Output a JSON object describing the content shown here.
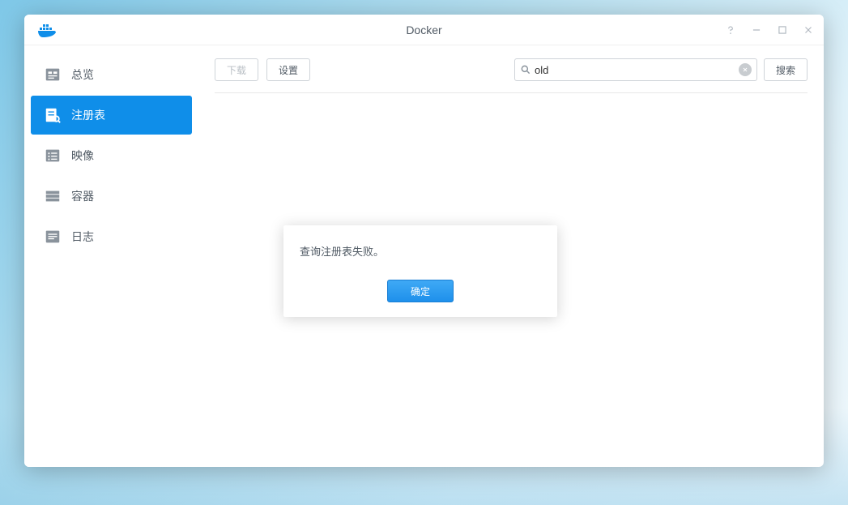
{
  "window": {
    "title": "Docker"
  },
  "sidebar": {
    "items": [
      {
        "label": "总览",
        "icon": "overview"
      },
      {
        "label": "注册表",
        "icon": "registry"
      },
      {
        "label": "映像",
        "icon": "image"
      },
      {
        "label": "容器",
        "icon": "container"
      },
      {
        "label": "日志",
        "icon": "log"
      }
    ],
    "active_index": 1
  },
  "toolbar": {
    "download_label": "下载",
    "settings_label": "设置",
    "search_value": "old",
    "search_button_label": "搜索"
  },
  "dialog": {
    "message": "查询注册表失败。",
    "ok_label": "确定"
  }
}
